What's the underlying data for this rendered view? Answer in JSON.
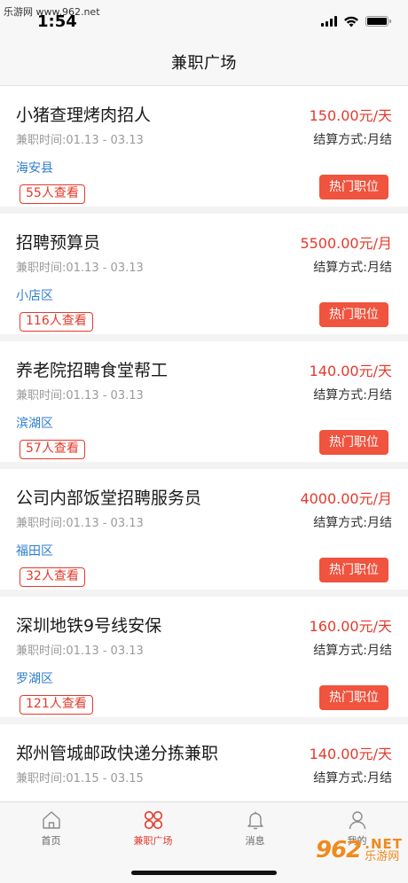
{
  "watermark": {
    "top_text": "乐游网 www.962.net",
    "logo_mark": "962",
    "logo_net": ".NET",
    "logo_name": "乐游网"
  },
  "status_bar": {
    "time": "1:54"
  },
  "nav": {
    "title": "兼职广场"
  },
  "jobs": [
    {
      "title": "小猪查理烤肉招人",
      "salary": "150.00元/天",
      "time": "兼职时间:01.13 - 03.13",
      "settlement": "结算方式:月结",
      "district": "海安县",
      "views": "55人查看",
      "hot_label": "热门职位"
    },
    {
      "title": "招聘预算员",
      "salary": "5500.00元/月",
      "time": "兼职时间:01.13 - 03.13",
      "settlement": "结算方式:月结",
      "district": "小店区",
      "views": "116人查看",
      "hot_label": "热门职位"
    },
    {
      "title": "养老院招聘食堂帮工",
      "salary": "140.00元/天",
      "time": "兼职时间:01.13 - 03.13",
      "settlement": "结算方式:月结",
      "district": "滨湖区",
      "views": "57人查看",
      "hot_label": "热门职位"
    },
    {
      "title": "公司内部饭堂招聘服务员",
      "salary": "4000.00元/月",
      "time": "兼职时间:01.13 - 03.13",
      "settlement": "结算方式:月结",
      "district": "福田区",
      "views": "32人查看",
      "hot_label": "热门职位"
    },
    {
      "title": "深圳地铁9号线安保",
      "salary": "160.00元/天",
      "time": "兼职时间:01.13 - 03.13",
      "settlement": "结算方式:月结",
      "district": "罗湖区",
      "views": "121人查看",
      "hot_label": "热门职位"
    },
    {
      "title": "郑州管城邮政快递分拣兼职",
      "salary": "140.00元/天",
      "time": "兼职时间:01.15 - 03.15",
      "settlement": "结算方式:月结"
    }
  ],
  "tabs": [
    {
      "label": "首页",
      "icon": "home-icon",
      "active": false
    },
    {
      "label": "兼职广场",
      "icon": "grid-icon",
      "active": true
    },
    {
      "label": "消息",
      "icon": "bell-icon",
      "active": false
    },
    {
      "label": "我的",
      "icon": "user-icon",
      "active": false
    }
  ],
  "colors": {
    "accent": "#e5392b",
    "button": "#f0533e",
    "district": "#2f7fd0",
    "muted": "#9a9a9a"
  }
}
